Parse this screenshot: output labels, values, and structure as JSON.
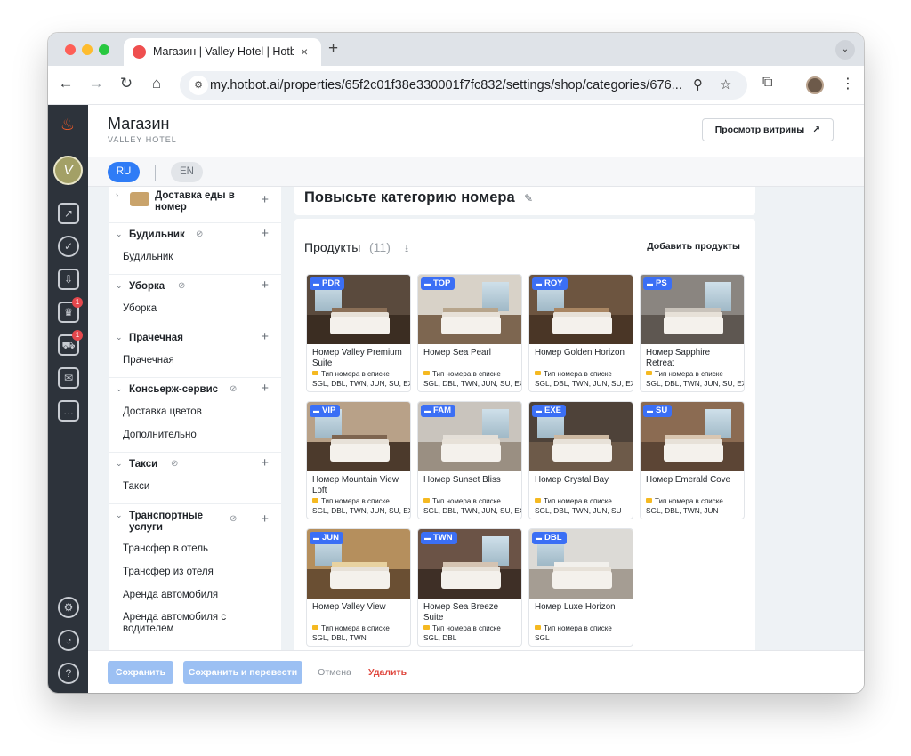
{
  "browser": {
    "tab_title": "Магазин | Valley Hotel | Hotbot",
    "tab_close": "×",
    "new_tab": "+",
    "tab_menu": "⌄",
    "url": "my.hotbot.ai/properties/65f2c01f38e330001f7fc832/settings/shop/categories/676...",
    "icons": {
      "back": "←",
      "forward": "→",
      "reload": "↻",
      "home": "⌂",
      "tune": "⚙",
      "zoom": "⚲",
      "star": "☆",
      "extensions": "⧉",
      "menu": "⋮"
    }
  },
  "rail": {
    "logo": "♨",
    "avatar": "V",
    "items": [
      {
        "icon": "analytics-icon",
        "glyph": "↗"
      },
      {
        "icon": "tasks-icon",
        "glyph": "✓"
      },
      {
        "icon": "inbox-icon",
        "glyph": "⇩"
      },
      {
        "icon": "crown-icon",
        "glyph": "♛",
        "badge": "1"
      },
      {
        "icon": "cart-icon",
        "glyph": "⛟",
        "badge": "1"
      },
      {
        "icon": "mail-icon",
        "glyph": "✉"
      },
      {
        "icon": "chat-icon",
        "glyph": "…"
      }
    ],
    "bottom": [
      {
        "icon": "settings-icon",
        "glyph": "⚙"
      },
      {
        "icon": "profile-icon",
        "glyph": "◔"
      },
      {
        "icon": "help-icon",
        "glyph": "?"
      }
    ]
  },
  "header": {
    "title": "Магазин",
    "subtitle": "VALLEY HOTEL",
    "preview_label": "Просмотр витрины",
    "preview_icon": "↗"
  },
  "languages": {
    "active": "RU",
    "inactive": "EN"
  },
  "categories": [
    {
      "name": "Доставка еды в номер",
      "items": []
    },
    {
      "name": "Будильник",
      "hidden_icon": true,
      "items": [
        "Будильник"
      ]
    },
    {
      "name": "Уборка",
      "hidden_icon": true,
      "items": [
        "Уборка"
      ]
    },
    {
      "name": "Прачечная",
      "hidden_icon": false,
      "items": [
        "Прачечная"
      ]
    },
    {
      "name": "Консьерж-сервис",
      "hidden_icon": true,
      "items": [
        "Доставка цветов",
        "Дополнительно"
      ]
    },
    {
      "name": "Такси",
      "hidden_icon": true,
      "items": [
        "Такси"
      ]
    },
    {
      "name": "Транспортные услуги",
      "hidden_icon": true,
      "items": [
        "Трансфер в отель",
        "Трансфер из отеля",
        "Аренда автомобиля",
        "Аренда автомобиля с водителем"
      ]
    }
  ],
  "main": {
    "title": "Повысьте категорию номера",
    "products_label": "Продукты",
    "products_count": "(11)",
    "add_products": "Добавить продукты",
    "room_type_label": "Тип номера в списке",
    "products": [
      {
        "code": "PDR",
        "name": "Номер Valley Premium Suite",
        "codes": "SGL, DBL, TWN, JUN, SU, EXE"
      },
      {
        "code": "TOP",
        "name": "Номер Sea Pearl",
        "codes": "SGL, DBL, TWN, JUN, SU, EXE"
      },
      {
        "code": "ROY",
        "name": "Номер Golden Horizon",
        "codes": "SGL, DBL, TWN, JUN, SU, EXE"
      },
      {
        "code": "PS",
        "name": "Номер Sapphire Retreat",
        "codes": "SGL, DBL, TWN, JUN, SU, EXE"
      },
      {
        "code": "VIP",
        "name": "Номер Mountain View Loft",
        "codes": "SGL, DBL, TWN, JUN, SU, EXE"
      },
      {
        "code": "FAM",
        "name": "Номер Sunset Bliss",
        "codes": "SGL, DBL, TWN, JUN, SU, EXE"
      },
      {
        "code": "EXE",
        "name": "Номер Crystal Bay",
        "codes": "SGL, DBL, TWN, JUN, SU"
      },
      {
        "code": "SU",
        "name": "Номер Emerald Cove",
        "codes": "SGL, DBL, TWN, JUN"
      },
      {
        "code": "JUN",
        "name": "Номер Valley View",
        "codes": "SGL, DBL, TWN"
      },
      {
        "code": "TWN",
        "name": "Номер Sea Breeze Suite",
        "codes": "SGL, DBL"
      },
      {
        "code": "DBL",
        "name": "Номер Luxe Horizon",
        "codes": "SGL"
      }
    ]
  },
  "footer": {
    "save": "Сохранить",
    "save_translate": "Сохранить и перевести",
    "cancel": "Отмена",
    "delete": "Удалить"
  },
  "colors": {
    "accent": "#2f7cf6",
    "badge": "#3b6ff5",
    "danger": "#e0483f",
    "rail": "#2d333b"
  }
}
